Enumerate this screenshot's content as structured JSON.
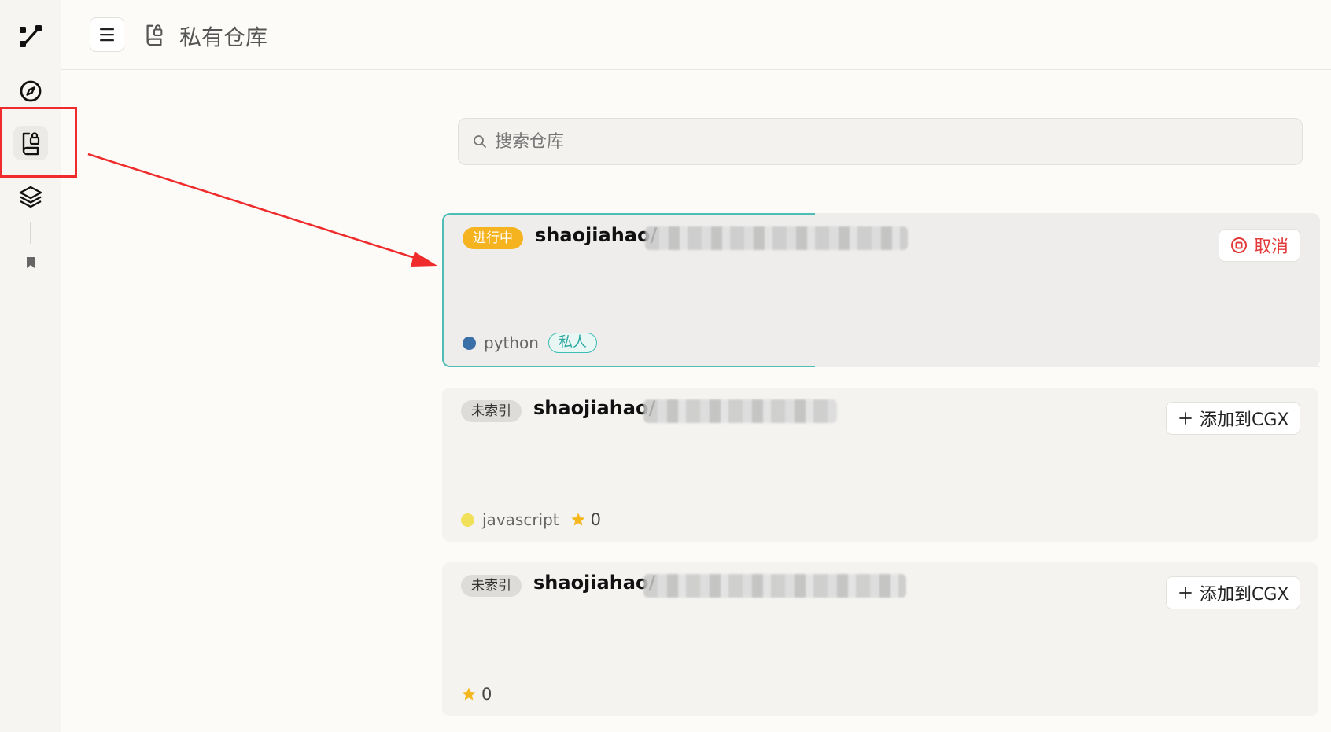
{
  "header": {
    "title": "私有仓库"
  },
  "search": {
    "placeholder": "搜索仓库",
    "value": ""
  },
  "repos": [
    {
      "status": "进行中",
      "owner_prefix": "shaojiahao/",
      "action_label": "取消",
      "language": "python",
      "language_color": "#3a6fa8",
      "visibility": "私人"
    },
    {
      "status": "未索引",
      "owner_prefix": "shaojiahao/",
      "action_label": "添加到CGX",
      "language": "javascript",
      "language_color": "#f0e05a",
      "stars": "0"
    },
    {
      "status": "未索引",
      "owner_prefix": "shaojiahao/",
      "action_label": "添加到CGX",
      "stars": "0"
    }
  ],
  "colors": {
    "accent_teal": "#4dbdb6",
    "status_progress": "#f4b31f",
    "cancel_red": "#e33a3a",
    "annotation_red": "#ef2b2b",
    "star_yellow": "#f5b71e"
  }
}
